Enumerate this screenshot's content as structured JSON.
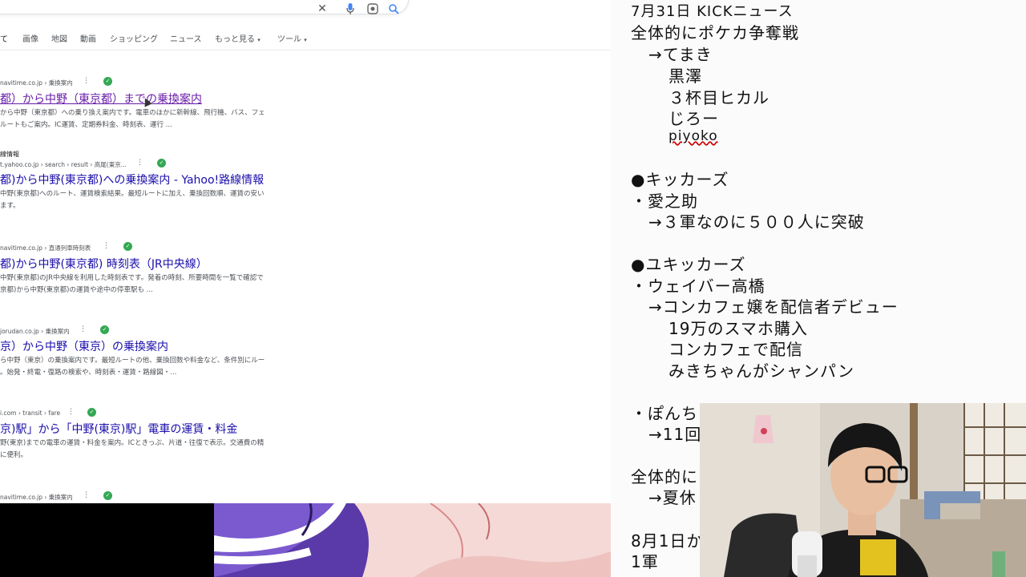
{
  "search": {
    "tabs": [
      {
        "label": "て"
      },
      {
        "label": "画像"
      },
      {
        "label": "地図"
      },
      {
        "label": "動画"
      },
      {
        "label": "ショッピング"
      },
      {
        "label": "ニュース"
      },
      {
        "label": "もっと見る"
      },
      {
        "label": "ツール"
      }
    ],
    "results": [
      {
        "sitename": "",
        "crumb": "navitime.co.jp › 乗換案内",
        "title": "都）から中野（東京都）までの乗換案内",
        "snippet": [
          "から中野（東京都）への乗り換え案内です。電車のほかに新幹線、飛行機、バス、フェ",
          "ルートもご案内。IC運賃、定期券料金、時刻表、運行 ..."
        ]
      },
      {
        "sitename": "線情報",
        "crumb": "t.yahoo.co.jp › search › result › 高尾(東京...",
        "title": "都)から中野(東京都)への乗換案内 - Yahoo!路線情報",
        "snippet": [
          "中野(東京都)へのルート、運賃検索結果。最短ルートに加え、乗換回数順、運賃の安い",
          "ます。"
        ]
      },
      {
        "sitename": "",
        "crumb": "navitime.co.jp › 直通列車時刻表",
        "title": "都)から中野(東京都) 時刻表（JR中央線）",
        "snippet": [
          "中野(東京都)のJR中央線を利用した時刻表です。発着の時刻、所要時間を一覧で確認で",
          "京都)から中野(東京都)の運賃や途中の停車駅も ..."
        ]
      },
      {
        "sitename": "",
        "crumb": "jorudan.co.jp › 乗換案内",
        "title": "京）から中野（東京）の乗換案内",
        "snippet": [
          "ら中野（東京）の乗換案内です。最短ルートの他、乗換回数や料金など、条件別にルー",
          "。始発・終電・復路の検索や、時刻表・運賃・路線図・..."
        ]
      },
      {
        "sitename": "",
        "crumb": "i.com › transit › fare",
        "title": "京)駅」から「中野(東京)駅」電車の運賃・料金",
        "snippet": [
          "野(東京)までの電車の運賃・料金を案内。ICときっぷ、片道・往復で表示。交通費の精",
          "に便利。"
        ]
      },
      {
        "sitename": "",
        "crumb": "navitime.co.jp › 乗換案内",
        "title": "",
        "snippet": []
      }
    ]
  },
  "notes": {
    "lines": [
      "7月31日 KICKニュース",
      "全体的にポケカ争奪戦",
      "→てまき",
      "黒澤",
      "３杯目ヒカル",
      "じろー",
      "piyoko",
      "●キッカーズ",
      "・愛之助",
      "→３軍なのに５００人に突破",
      "●ユキッカーズ",
      "・ウェイバー高橋",
      "→コンカフェ嬢を配信者デビュー",
      "19万のスマホ購入",
      "コンカフェで配信",
      "みきちゃんがシャンパン",
      "・ぽんち",
      "→11回",
      "全体的に",
      "→夏休",
      "8月1日か",
      "1軍"
    ]
  },
  "colors": {
    "link": "#1a0dab",
    "visited": "#681da8",
    "snippet": "#4d5156",
    "verified": "#34a853"
  }
}
